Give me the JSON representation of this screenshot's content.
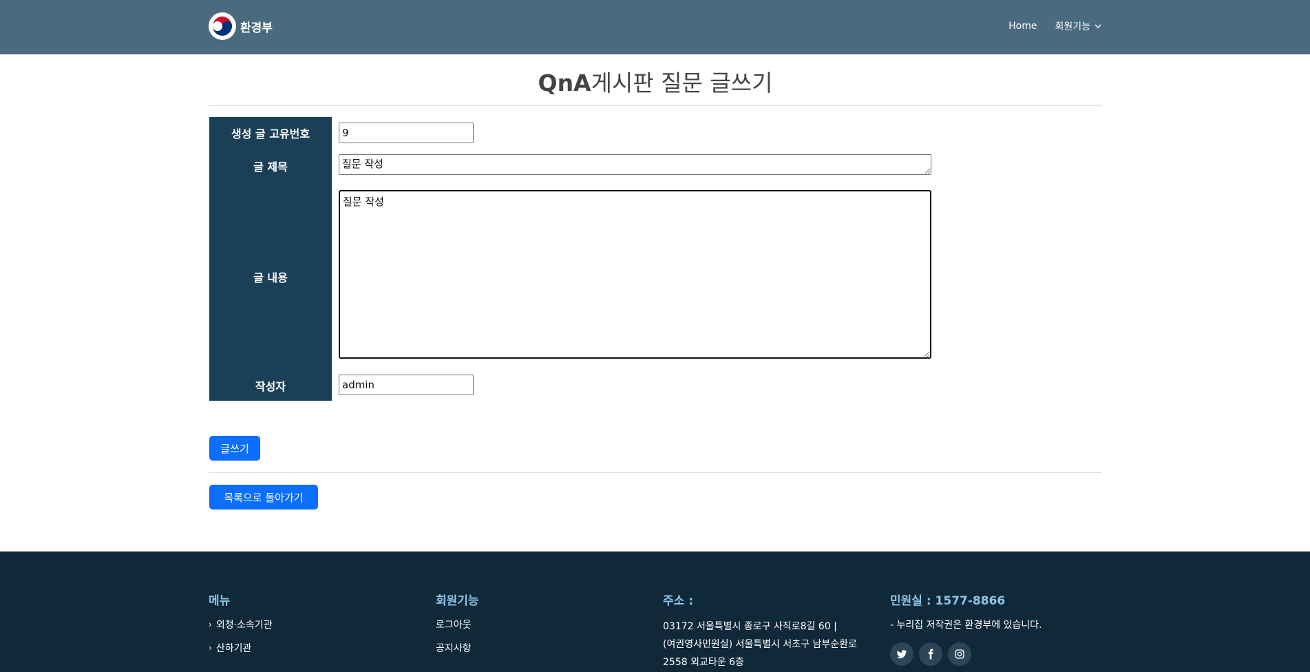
{
  "header": {
    "logo_text": "환경부",
    "nav": [
      {
        "label": "Home"
      },
      {
        "label": "회원기능"
      }
    ]
  },
  "page": {
    "title_bold": "QnA",
    "title_rest": "게시판 질문 글쓰기"
  },
  "form": {
    "id_label": "생성 글 고유번호",
    "id_value": "9",
    "title_label": "글 제목",
    "title_value": "질문 작성",
    "content_label": "글 내용",
    "content_value": "질문 작성",
    "writer_label": "작성자",
    "writer_value": "admin",
    "submit_label": "글쓰기",
    "back_label": "목록으로 돌아가기"
  },
  "footer": {
    "menu": {
      "heading": "메뉴",
      "items": [
        "외청·소속기관",
        "산하기관"
      ]
    },
    "member": {
      "heading": "회원기능",
      "items": [
        "로그아웃",
        "공지사항"
      ]
    },
    "address": {
      "heading": "주소 :",
      "line1": "03172 서울특별시 종로구 사직로8길 60 |",
      "line2": "(여권영사민원실) 서울특별시 서초구 남부순환로",
      "line3": "2558 외교타운 6층"
    },
    "contact": {
      "heading": "민원실 : 1577-8866",
      "copyright": "- 누리집 저작권은 환경부에 있습니다.",
      "socials": [
        "twitter-icon",
        "facebook-icon",
        "instagram-icon"
      ]
    }
  },
  "colors": {
    "header_bg": "#4a6a80",
    "label_bg": "#1a3f57",
    "button": "#0d6efd",
    "footer_bg": "#0f2939",
    "footer_heading": "#8ec5e8"
  }
}
